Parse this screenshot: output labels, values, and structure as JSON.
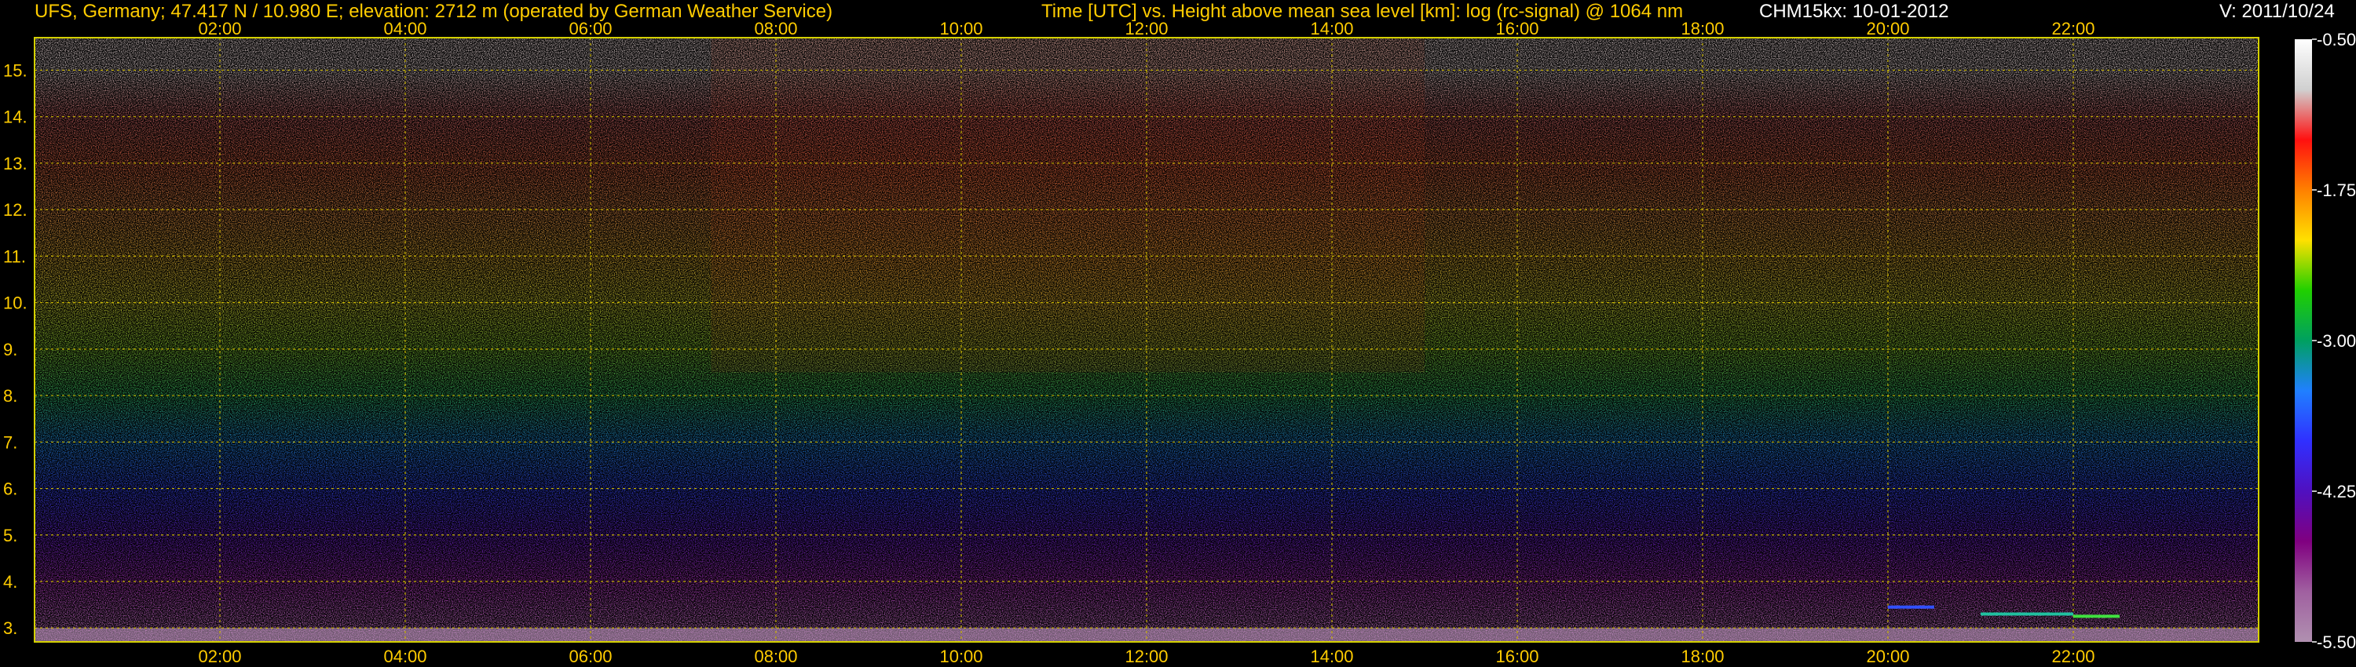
{
  "header": {
    "station": "UFS, Germany; 47.417 N / 10.980 E; elevation: 2712 m  (operated by German Weather Service)",
    "axes_title": "Time [UTC] vs. Height above mean sea level [km]: log (rc-signal) @ 1064 nm",
    "instrument_date": "CHM15kx: 10-01-2012",
    "version": "V: 2011/10/24"
  },
  "colors": {
    "background": "#000000",
    "frame": "#d4d000",
    "grid": "#c8b400",
    "tick_text": "#ffcc00"
  },
  "chart_data": {
    "type": "heatmap",
    "title": "Time [UTC] vs. Height above mean sea level [km]: log (rc-signal) @ 1064 nm",
    "xlabel": "Time [UTC]",
    "ylabel": "Height above mean sea level [km]",
    "x_ticks": [
      "02:00",
      "04:00",
      "06:00",
      "08:00",
      "10:00",
      "12:00",
      "14:00",
      "16:00",
      "18:00",
      "20:00",
      "22:00"
    ],
    "x_tick_hours": [
      2,
      4,
      6,
      8,
      10,
      12,
      14,
      16,
      18,
      20,
      22
    ],
    "xlim_hours": [
      0,
      24
    ],
    "y_ticks": [
      "3.",
      "4.",
      "5.",
      "6.",
      "7.",
      "8.",
      "9.",
      "10.",
      "11.",
      "12.",
      "13.",
      "14.",
      "15."
    ],
    "y_tick_values": [
      3,
      4,
      5,
      6,
      7,
      8,
      9,
      10,
      11,
      12,
      13,
      14,
      15
    ],
    "ylim_km": [
      2.7,
      15.7
    ],
    "grid": true,
    "colorbar": {
      "label": "log (rc-signal)",
      "range": [
        -5.5,
        -0.5
      ],
      "tick_labels": [
        "-0.50",
        "-1.75",
        "-3.00",
        "-4.25",
        "-5.50"
      ],
      "tick_values": [
        -0.5,
        -1.75,
        -3.0,
        -4.25,
        -5.5
      ],
      "stops": [
        "#ffffff",
        "#d0d0d0",
        "#ff1010",
        "#ff8000",
        "#ffe000",
        "#20d000",
        "#00a060",
        "#2080ff",
        "#3030ff",
        "#5010c0",
        "#800080",
        "#a060a0",
        "#b090b0"
      ]
    },
    "noise_field_description_values": {
      "height_bands_km": [
        3,
        4,
        5,
        6,
        7,
        8,
        9,
        10,
        11,
        12,
        13,
        14,
        15
      ],
      "color_by_height": [
        "#c070c0",
        "#a030b0",
        "#6020c0",
        "#3040e0",
        "#2080d0",
        "#30b060",
        "#80c030",
        "#c0c030",
        "#d0a030",
        "#d08040",
        "#d06040",
        "#c06060",
        "#d0c0c0"
      ]
    },
    "cloud_traces": [
      {
        "start_hour": 20.0,
        "end_hour": 20.5,
        "height_km": 3.45,
        "color": "#3050ff"
      },
      {
        "start_hour": 21.0,
        "end_hour": 22.0,
        "height_km": 3.3,
        "color": "#20c0a0"
      },
      {
        "start_hour": 22.0,
        "end_hour": 22.5,
        "height_km": 3.25,
        "color": "#40e040"
      }
    ]
  }
}
